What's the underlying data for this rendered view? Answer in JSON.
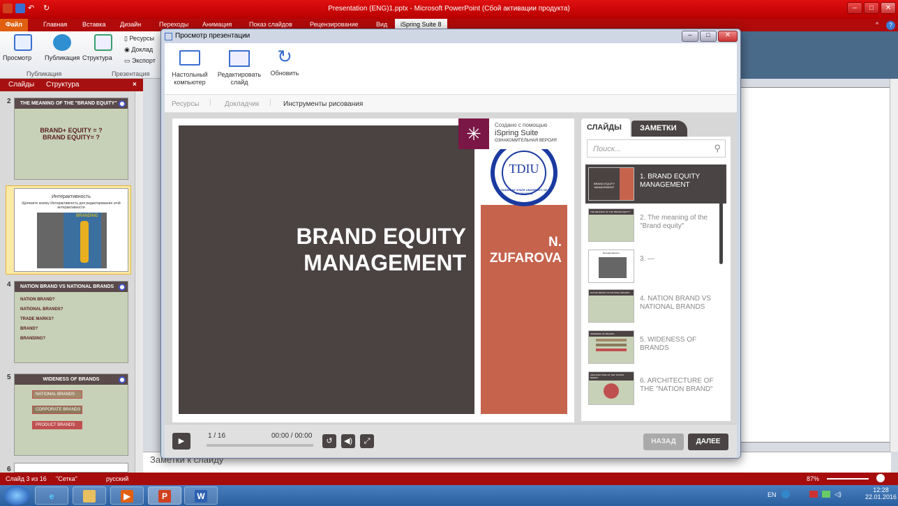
{
  "app": {
    "window_title": "Presentation (ENG)1.pptx  -  Microsoft PowerPoint (Сбой активации продукта)",
    "file_tab": "Файл",
    "tabs": [
      "Главная",
      "Вставка",
      "Дизайн",
      "Переходы",
      "Анимация",
      "Показ слайдов",
      "Рецензирование",
      "Вид",
      "iSpring Suite 8"
    ],
    "ribbon": {
      "preview": "Просмотр",
      "publish": "Публикация",
      "structure": "Структура",
      "resources": "Ресурсы",
      "narration": "Доклад",
      "export": "Экспорт",
      "group_publish": "Публикация",
      "group_presentation": "Презентация"
    },
    "left_tabs": {
      "slides": "Слайды",
      "outline": "Структура",
      "close": "×"
    },
    "notes_placeholder": "Заметки к слайду",
    "status": {
      "slide": "Слайд 3 из 16",
      "theme": "\"Сетка\"",
      "lang": "русский",
      "zoom": "87%"
    },
    "taskbar": {
      "lang": "EN",
      "time": "12:28",
      "date": "22.01.2016"
    }
  },
  "thumbnails": [
    {
      "num": "2",
      "title": "THE MEANING OF THE \"BRAND EQUITY\"",
      "lines": [
        "BRAND+ EQUITY = ?",
        "BRAND EQUITY= ?"
      ]
    },
    {
      "num": "3",
      "title": "Интерактивность",
      "lines": [
        "Щелкните кнопку Интерактивность для редактирования этой интерактивности"
      ],
      "image_label": "BRANDING"
    },
    {
      "num": "4",
      "title": "NATION BRAND VS NATIONAL BRANDS",
      "lines": [
        "NATION BRAND?",
        "NATIONAL BRANDS?",
        "TRADE MARKS?",
        "BRAND?",
        "BRANDING?"
      ]
    },
    {
      "num": "5",
      "title": "WIDENESS OF BRANDS",
      "lines": [
        "NATIONAL BRANDS",
        "CORPORATE BRANDS",
        "PRODUCT BRANDS"
      ]
    },
    {
      "num": "6",
      "title": "",
      "lines": []
    }
  ],
  "dialog": {
    "title": "Просмотр презентации",
    "toolbar": [
      {
        "label": "Настольный компьютер",
        "icon": "desktop-icon"
      },
      {
        "label": "Редактировать слайд",
        "icon": "edit-slide-icon"
      },
      {
        "label": "Обновить",
        "icon": "refresh-icon"
      }
    ],
    "subtabs": [
      "Ресурсы",
      "Докладчик",
      "Инструменты рисования"
    ],
    "slide": {
      "title": "BRAND EQUITY MANAGEMENT",
      "author": "N. ZUFAROVA",
      "logo_text": "TDIU",
      "logo_ring": "TASHKENT STATE UNIVERSITY OF ECONOMICS"
    },
    "watermark": {
      "line1": "Создано с помощью",
      "line2": "iSpring Suite",
      "line3": "ОЗНАКОМИТЕЛЬНАЯ ВЕРСИЯ"
    },
    "side_tabs": {
      "slides": "СЛАЙДЫ",
      "notes": "ЗАМЕТКИ"
    },
    "search_placeholder": "Поиск...",
    "slide_list": [
      {
        "label": "1. BRAND EQUITY MANAGEMENT",
        "mini_title": "BRAND EQUITY MANAGEMENT"
      },
      {
        "label": "2. The meaning of the \"Brand equity\"",
        "mini_title": "THE MEANING OF THE \"BRAND EQUITY\""
      },
      {
        "label": "3. —",
        "mini_title": "Интерактивность"
      },
      {
        "label": "4. NATION BRAND VS NATIONAL BRANDS",
        "mini_title": "NATION BRAND VS NATIONAL BRANDS"
      },
      {
        "label": "5. WIDENESS OF BRANDS",
        "mini_title": "WIDENESS OF BRANDS"
      },
      {
        "label": "6. ARCHITECTURE OF THE \"NATION BRAND\"",
        "mini_title": "ARCHITECTURE OF THE \"NATION BRAND\""
      }
    ],
    "player": {
      "slide_counter": "1 / 16",
      "time": "00:00 / 00:00",
      "back": "НАЗАД",
      "next": "ДАЛЕЕ"
    }
  },
  "colors": {
    "accent_red": "#b00a0a",
    "slide_dark": "#4b4242",
    "slide_terracotta": "#c6634d",
    "ispring_plum": "#7a1746"
  }
}
